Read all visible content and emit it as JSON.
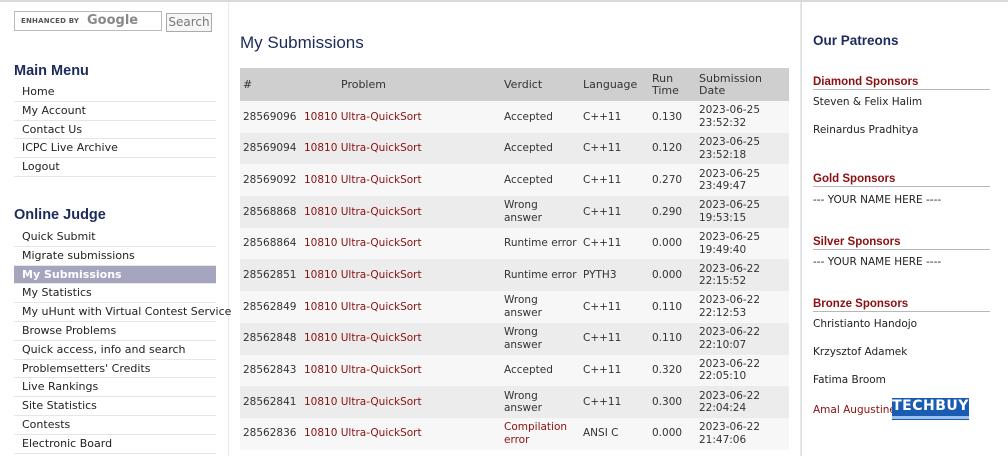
{
  "search": {
    "enhanced_label": "ENHANCED BY",
    "google_label": "Google",
    "button_label": "Search"
  },
  "main_menu": {
    "title": "Main Menu",
    "items": [
      "Home",
      "My Account",
      "Contact Us",
      "ICPC Live Archive",
      "Logout"
    ]
  },
  "online_judge": {
    "title": "Online Judge",
    "items": [
      "Quick Submit",
      "Migrate submissions",
      "My Submissions",
      "My Statistics",
      "My uHunt with Virtual Contest Service",
      "Browse Problems",
      "Quick access, info and search",
      "Problemsetters' Credits",
      "Live Rankings",
      "Site Statistics",
      "Contests",
      "Electronic Board"
    ],
    "active": "My Submissions"
  },
  "page_title": "My Submissions",
  "table": {
    "headers": [
      "#",
      "Problem",
      "Verdict",
      "Language",
      "Run Time",
      "Submission Date"
    ],
    "rows": [
      {
        "id": "28569096",
        "pid": "10810",
        "pname": "Ultra-QuickSort",
        "verdict": "Accepted",
        "lang": "C++11",
        "time": "0.130",
        "date": "2023-06-25",
        "clock": "23:52:32"
      },
      {
        "id": "28569094",
        "pid": "10810",
        "pname": "Ultra-QuickSort",
        "verdict": "Accepted",
        "lang": "C++11",
        "time": "0.120",
        "date": "2023-06-25",
        "clock": "23:52:18"
      },
      {
        "id": "28569092",
        "pid": "10810",
        "pname": "Ultra-QuickSort",
        "verdict": "Accepted",
        "lang": "C++11",
        "time": "0.270",
        "date": "2023-06-25",
        "clock": "23:49:47"
      },
      {
        "id": "28568868",
        "pid": "10810",
        "pname": "Ultra-QuickSort",
        "verdict": "Wrong answer",
        "lang": "C++11",
        "time": "0.290",
        "date": "2023-06-25",
        "clock": "19:53:15"
      },
      {
        "id": "28568864",
        "pid": "10810",
        "pname": "Ultra-QuickSort",
        "verdict": "Runtime error",
        "lang": "C++11",
        "time": "0.000",
        "date": "2023-06-25",
        "clock": "19:49:40"
      },
      {
        "id": "28562851",
        "pid": "10810",
        "pname": "Ultra-QuickSort",
        "verdict": "Runtime error",
        "lang": "PYTH3",
        "time": "0.000",
        "date": "2023-06-22",
        "clock": "22:15:52"
      },
      {
        "id": "28562849",
        "pid": "10810",
        "pname": "Ultra-QuickSort",
        "verdict": "Wrong answer",
        "lang": "C++11",
        "time": "0.110",
        "date": "2023-06-22",
        "clock": "22:12:53"
      },
      {
        "id": "28562848",
        "pid": "10810",
        "pname": "Ultra-QuickSort",
        "verdict": "Wrong answer",
        "lang": "C++11",
        "time": "0.110",
        "date": "2023-06-22",
        "clock": "22:10:07"
      },
      {
        "id": "28562843",
        "pid": "10810",
        "pname": "Ultra-QuickSort",
        "verdict": "Accepted",
        "lang": "C++11",
        "time": "0.320",
        "date": "2023-06-22",
        "clock": "22:05:10"
      },
      {
        "id": "28562841",
        "pid": "10810",
        "pname": "Ultra-QuickSort",
        "verdict": "Wrong answer",
        "lang": "C++11",
        "time": "0.300",
        "date": "2023-06-22",
        "clock": "22:04:24"
      },
      {
        "id": "28562836",
        "pid": "10810",
        "pname": "Ultra-QuickSort",
        "verdict": "Compilation error",
        "lang": "ANSI C",
        "time": "0.000",
        "date": "2023-06-22",
        "clock": "21:47:06"
      }
    ]
  },
  "patreons": {
    "title": "Our Patreons",
    "diamond": {
      "title": "Diamond Sponsors",
      "names": [
        "Steven & Felix Halim",
        "Reinardus Pradhitya"
      ]
    },
    "gold": {
      "title": "Gold Sponsors",
      "names": [
        "--- YOUR NAME HERE ----"
      ]
    },
    "silver": {
      "title": "Silver Sponsors",
      "names": [
        "--- YOUR NAME HERE ----"
      ]
    },
    "bronze": {
      "title": "Bronze Sponsors",
      "names": [
        "Christianto Handojo",
        "Krzysztof Adamek",
        "Fatima Broom",
        "Amal Augustine"
      ]
    },
    "logo_text": "TECHBUY"
  },
  "colors": {
    "brand_navy": "#1c2a5c",
    "link_red": "#8b1010",
    "active_menu_bg": "#a5a5bf",
    "header_gray": "#cfcfcf"
  }
}
